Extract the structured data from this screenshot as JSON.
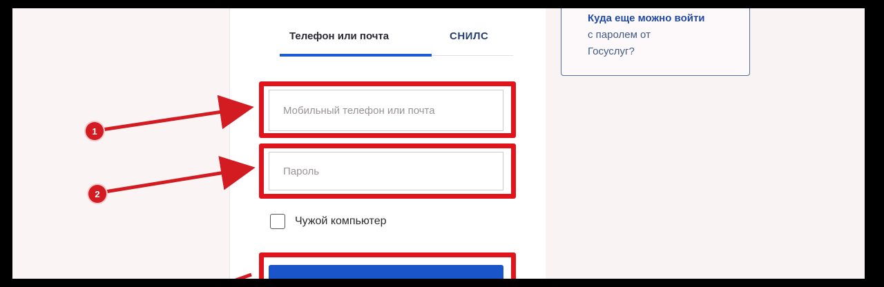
{
  "tabs": {
    "active_label": "Телефон или почта",
    "inactive_label": "СНИЛС"
  },
  "login": {
    "login_placeholder": "Мобильный телефон или почта",
    "password_placeholder": "Пароль",
    "checkbox_label": "Чужой компьютер",
    "submit_label": ""
  },
  "info_box": {
    "line1": "Куда еще можно войти",
    "line2": "с паролем от",
    "line3": "Госуслуг?"
  },
  "markers": {
    "first": "1",
    "second": "2"
  },
  "colors": {
    "highlight": "#e1141c",
    "accent": "#1f5bd1",
    "button": "#1a56c9"
  }
}
